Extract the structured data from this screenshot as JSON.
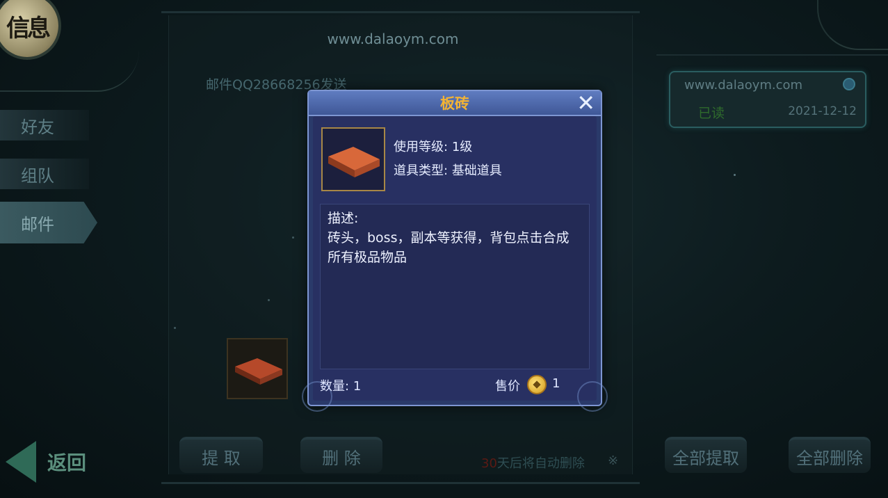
{
  "top": {
    "watermark": "www.dalaoym.com",
    "seal_text": "信息"
  },
  "tabs": [
    {
      "label": "好友"
    },
    {
      "label": "组队"
    },
    {
      "label": "邮件"
    }
  ],
  "back_label": "返回",
  "mail": {
    "body": "邮件QQ28668256发送",
    "buttons": {
      "take": "提 取",
      "delete": "删 除"
    },
    "notice_days": "30",
    "notice_text": "天后将自动删除",
    "close_icon": "※"
  },
  "mail_list": [
    {
      "sender": "www.dalaoym.com",
      "status": "已读",
      "date": "2021-12-12"
    }
  ],
  "list_buttons": {
    "take_all": "全部提取",
    "delete_all": "全部删除"
  },
  "popup": {
    "title": "板砖",
    "level_label": "使用等级:",
    "level_value": "1级",
    "type_label": "道具类型:",
    "type_value": "基础道具",
    "desc_label": "描述:",
    "desc_line1": "砖头，boss，副本等获得，背包点击合成",
    "desc_line2": "所有极品物品",
    "qty_label": "数量:",
    "qty_value": "1",
    "price_label": "售价",
    "price_value": "1",
    "close": "✕"
  },
  "colors": {
    "title": "#f2b335",
    "popup_bg": "#2a3a6a",
    "read_status": "#2f6b2c"
  }
}
